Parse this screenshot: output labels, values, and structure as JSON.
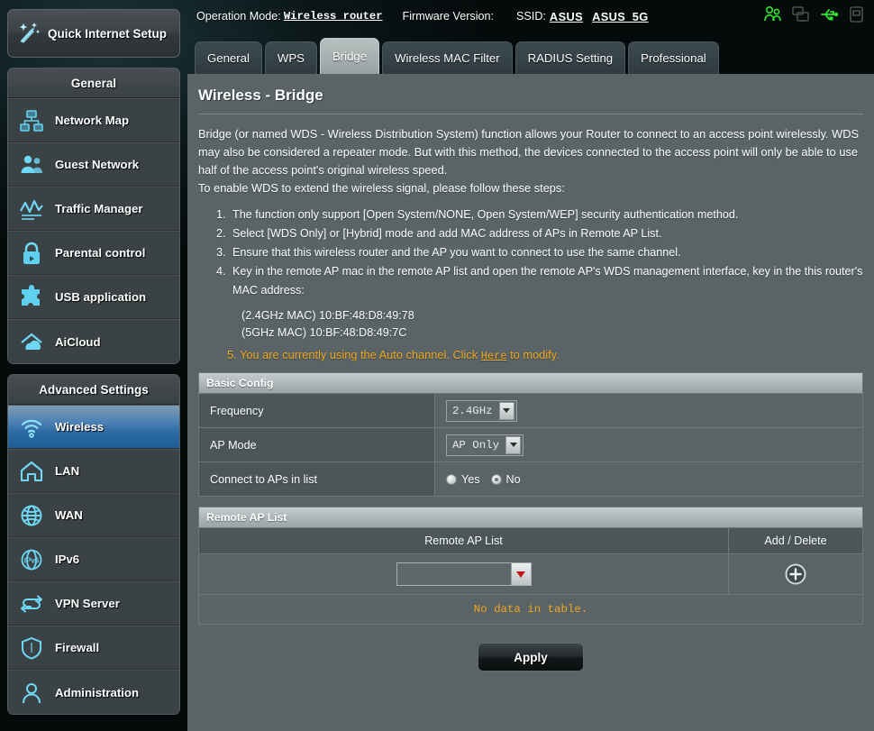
{
  "topbar": {
    "operation_mode_label": "Operation Mode:",
    "operation_mode_value": "Wireless router",
    "firmware_label": "Firmware Version:",
    "firmware_value": "",
    "ssid_label": "SSID:",
    "ssid_1": "ASUS",
    "ssid_2": "ASUS_5G",
    "icons": [
      "users-icon",
      "clone-devices-icon",
      "usb-icon",
      "printer-icon"
    ],
    "colors": {
      "icon_active": "#2ee62e",
      "icon_inactive": "#3f4a4a"
    }
  },
  "sidebar": {
    "quick_setup": {
      "label": "Quick Internet Setup",
      "icon": "magic-wand-icon"
    },
    "general_header": "General",
    "general_items": [
      {
        "label": "Network Map",
        "icon": "network-map-icon"
      },
      {
        "label": "Guest Network",
        "icon": "guest-network-icon"
      },
      {
        "label": "Traffic Manager",
        "icon": "traffic-manager-icon"
      },
      {
        "label": "Parental control",
        "icon": "lock-icon"
      },
      {
        "label": "USB application",
        "icon": "puzzle-icon"
      },
      {
        "label": "AiCloud",
        "icon": "cloud-icon"
      }
    ],
    "advanced_header": "Advanced Settings",
    "advanced_items": [
      {
        "label": "Wireless",
        "icon": "wifi-icon",
        "active": true
      },
      {
        "label": "LAN",
        "icon": "home-icon",
        "active": false
      },
      {
        "label": "WAN",
        "icon": "globe-icon",
        "active": false
      },
      {
        "label": "IPv6",
        "icon": "ipv6-globe-icon",
        "active": false
      },
      {
        "label": "VPN Server",
        "icon": "vpn-arrows-icon",
        "active": false
      },
      {
        "label": "Firewall",
        "icon": "shield-icon",
        "active": false
      },
      {
        "label": "Administration",
        "icon": "user-icon",
        "active": false
      }
    ]
  },
  "tabs": [
    {
      "label": "General",
      "active": false
    },
    {
      "label": "WPS",
      "active": false
    },
    {
      "label": "Bridge",
      "active": true
    },
    {
      "label": "Wireless MAC Filter",
      "active": false
    },
    {
      "label": "RADIUS Setting",
      "active": false
    },
    {
      "label": "Professional",
      "active": false
    }
  ],
  "page": {
    "title": "Wireless - Bridge",
    "description_p1": "Bridge (or named WDS - Wireless Distribution System) function allows your Router to connect to an access point wirelessly. WDS may also be considered a repeater mode. But with this method, the devices connected to the access point will only be able to use half of the access point's original wireless speed.",
    "description_p2": "To enable WDS to extend the wireless signal, please follow these steps:",
    "steps": [
      "The function only support [Open System/NONE, Open System/WEP] security authentication method.",
      "Select [WDS Only] or [Hybrid] mode and add MAC address of APs in Remote AP List.",
      "Ensure that this wireless router and the AP you want to connect to use the same channel.",
      "Key in the remote AP mac in the remote AP list and open the remote AP's WDS management interface, key in the this router's MAC address:"
    ],
    "mac_24": "(2.4GHz MAC) 10:BF:48:D8:49:78",
    "mac_5": "(5GHz MAC) 10:BF:48:D8:49:7C",
    "note_number": "5.",
    "note_text_before": "You are currently using the Auto channel. Click",
    "note_link": "Here",
    "note_text_after": "to modify.",
    "note_color": "#f0a71c"
  },
  "basic_config": {
    "header": "Basic Config",
    "frequency_label": "Frequency",
    "frequency_value": "2.4GHz",
    "ap_mode_label": "AP Mode",
    "ap_mode_value": "AP Only",
    "connect_label": "Connect to APs in list",
    "radio_yes": "Yes",
    "radio_no": "No",
    "radio_selected": "No"
  },
  "remote_ap": {
    "header": "Remote AP List",
    "col_list": "Remote AP List",
    "col_action": "Add / Delete",
    "input_value": "",
    "add_icon": "plus-circle-icon",
    "empty_message": "No data in table."
  },
  "footer": {
    "apply_label": "Apply"
  }
}
